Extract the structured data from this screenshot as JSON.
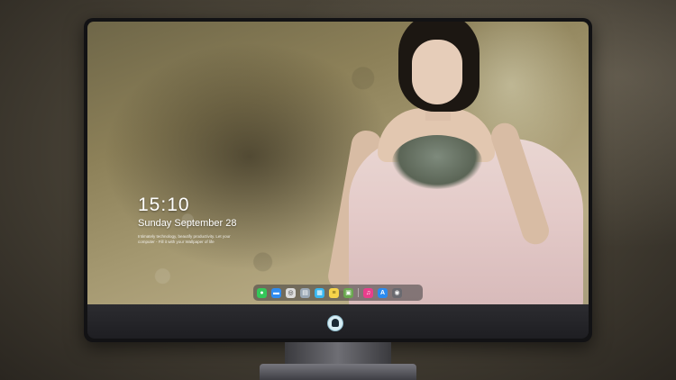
{
  "lockscreen": {
    "time": "15:10",
    "date": "Sunday September 28",
    "tagline": "Intimately technology, beautify productivity. Let your computer - Fill it with your Wallpaper of life"
  },
  "dock": {
    "items": [
      {
        "name": "messages-icon",
        "color": "#34c759",
        "glyph": "●"
      },
      {
        "name": "files-icon",
        "color": "#2f8cf0",
        "glyph": "▬"
      },
      {
        "name": "safari-icon",
        "color": "#dcdcdc",
        "glyph": "◎"
      },
      {
        "name": "preview-icon",
        "color": "#9aa7b4",
        "glyph": "▤"
      },
      {
        "name": "clapper-icon",
        "color": "#38b7f0",
        "glyph": "▦"
      },
      {
        "name": "notes-icon",
        "color": "#f6d34a",
        "glyph": "≡"
      },
      {
        "name": "photos-icon",
        "color": "#6aa84f",
        "glyph": "▣"
      },
      {
        "name": "music-icon",
        "color": "#e93e8c",
        "glyph": "♫"
      },
      {
        "name": "appstore-icon",
        "color": "#2b8bf0",
        "glyph": "A"
      },
      {
        "name": "camera-icon",
        "color": "#6a6a70",
        "glyph": "◉"
      }
    ]
  },
  "colors": {
    "background": "#4a4438",
    "bezel": "#121214",
    "chin": "#2c2c30"
  }
}
